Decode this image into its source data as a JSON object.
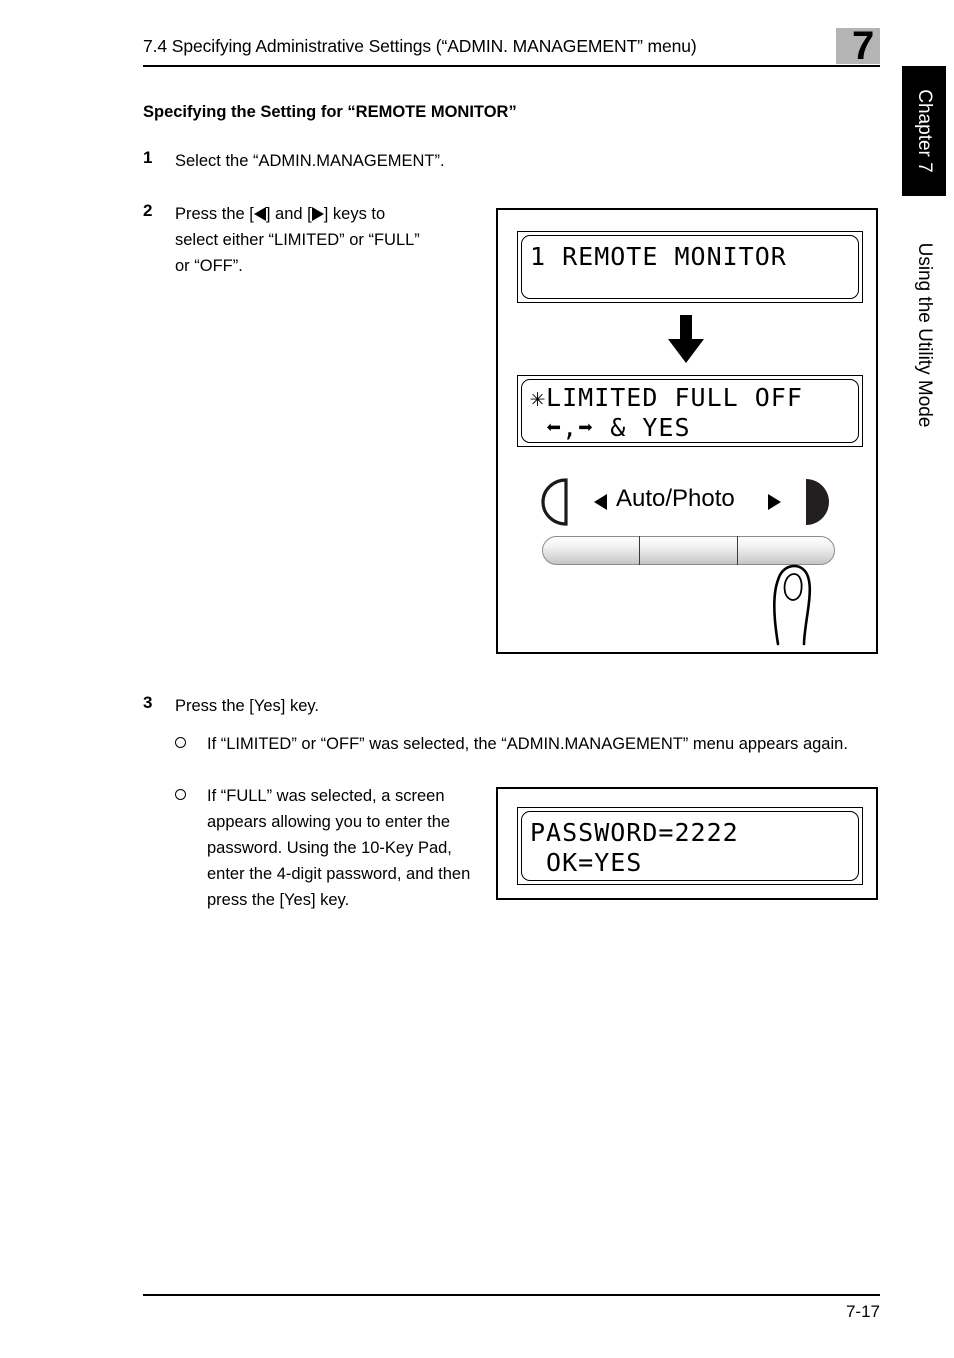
{
  "header": {
    "title": "7.4 Specifying Administrative Settings (“ADMIN. MANAGEMENT” menu)",
    "chapter_number": "7"
  },
  "side_tab": {
    "chapter_label": "Chapter 7",
    "section_label": "Using the Utility Mode"
  },
  "content": {
    "section_heading": "Specifying the Setting for “REMOTE MONITOR”",
    "steps": [
      {
        "number": "1",
        "text": "Select the “ADMIN.MANAGEMENT”."
      },
      {
        "number": "2",
        "text_part1": "Press the [",
        "text_part2": "] and [",
        "text_part3": "] keys to",
        "line2": "select either “LIMITED” or “FULL”",
        "line3": "or “OFF”."
      },
      {
        "number": "3",
        "text": "Press the [Yes] key."
      }
    ],
    "bullets": [
      {
        "text": "If “LIMITED” or “OFF” was selected, the “ADMIN.MANAGEMENT” menu appears again."
      },
      {
        "text": "If “FULL” was selected, a screen appears allowing you to enter the password. Using the 10-Key Pad, enter the 4-digit password, and then press the [Yes] key."
      }
    ]
  },
  "illustration": {
    "lcd_top": {
      "line1": "1 REMOTE MONITOR",
      "line2": ""
    },
    "lcd_bottom": {
      "line1": "✳LIMITED FULL OFF",
      "line2": " ⬅,➡ & YES"
    },
    "panel": {
      "label": "Auto/Photo",
      "left_arrow": "left-triangle",
      "right_arrow": "right-triangle",
      "left_icon": "half-circle-outline-icon",
      "right_icon": "half-circle-filled-icon",
      "finger": "pressing-finger-icon"
    },
    "flow_arrow": "down-arrow"
  },
  "password_screen": {
    "line1": "PASSWORD=2222",
    "line2": " OK=YES"
  },
  "footer": {
    "page_number": "7-17"
  },
  "colors": {
    "chapter_box_gray": "#b4b4b4",
    "tab_black": "#000000",
    "text": "#000000"
  }
}
